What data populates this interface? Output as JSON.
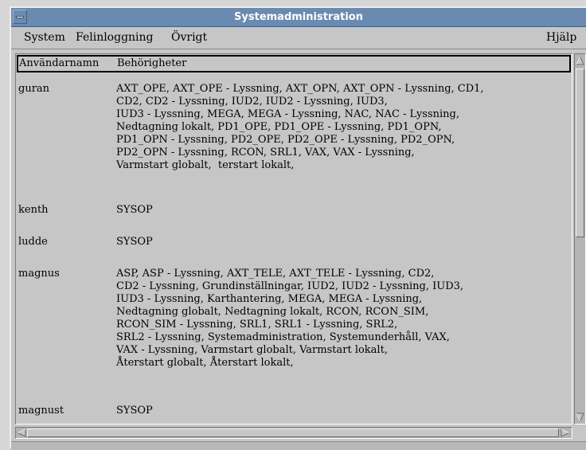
{
  "window": {
    "title": "Systemadministration"
  },
  "menubar": {
    "items": [
      "System",
      "Felinloggning",
      "Övrigt"
    ],
    "help": "Hjälp"
  },
  "table": {
    "headers": [
      "Användarnamn",
      "Behörigheter"
    ],
    "rows": [
      {
        "user": "guran",
        "permissions": [
          "AXT_OPE, AXT_OPE - Lyssning, AXT_OPN, AXT_OPN - Lyssning, CD1,",
          "CD2, CD2 - Lyssning, IUD2, IUD2 - Lyssning, IUD3,",
          "IUD3 - Lyssning, MEGA, MEGA - Lyssning, NAC, NAC - Lyssning,",
          "Nedtagning lokalt, PD1_OPE, PD1_OPE - Lyssning, PD1_OPN,",
          "PD1_OPN - Lyssning, PD2_OPE, PD2_OPE - Lyssning, PD2_OPN,",
          "PD2_OPN - Lyssning, RCON, SRL1, VAX, VAX - Lyssning,",
          "Varmstart globalt,  terstart lokalt,"
        ]
      },
      {
        "user": "kenth",
        "permissions": [
          "SYSOP"
        ]
      },
      {
        "user": "ludde",
        "permissions": [
          "SYSOP"
        ]
      },
      {
        "user": "magnus",
        "permissions": [
          "ASP, ASP - Lyssning, AXT_TELE, AXT_TELE - Lyssning, CD2,",
          "CD2 - Lyssning, Grundinställningar, IUD2, IUD2 - Lyssning, IUD3,",
          "IUD3 - Lyssning, Karthantering, MEGA, MEGA - Lyssning,",
          "Nedtagning globalt, Nedtagning lokalt, RCON, RCON_SIM,",
          "RCON_SIM - Lyssning, SRL1, SRL1 - Lyssning, SRL2,",
          "SRL2 - Lyssning, Systemadministration, Systemunderhåll, VAX,",
          "VAX - Lyssning, Varmstart globalt, Varmstart lokalt,",
          "Återstart globalt, Återstart lokalt,"
        ]
      },
      {
        "user": "magnust",
        "permissions": [
          "SYSOP"
        ]
      }
    ]
  },
  "icons": {
    "system_menu": "window-menu-icon",
    "scroll_up": "arrow-up-icon",
    "scroll_down": "arrow-down-icon",
    "scroll_left": "arrow-left-icon",
    "scroll_right": "arrow-right-icon"
  },
  "colors": {
    "titlebar": "#6b8ab0",
    "window_bg": "#c6c6c6"
  }
}
